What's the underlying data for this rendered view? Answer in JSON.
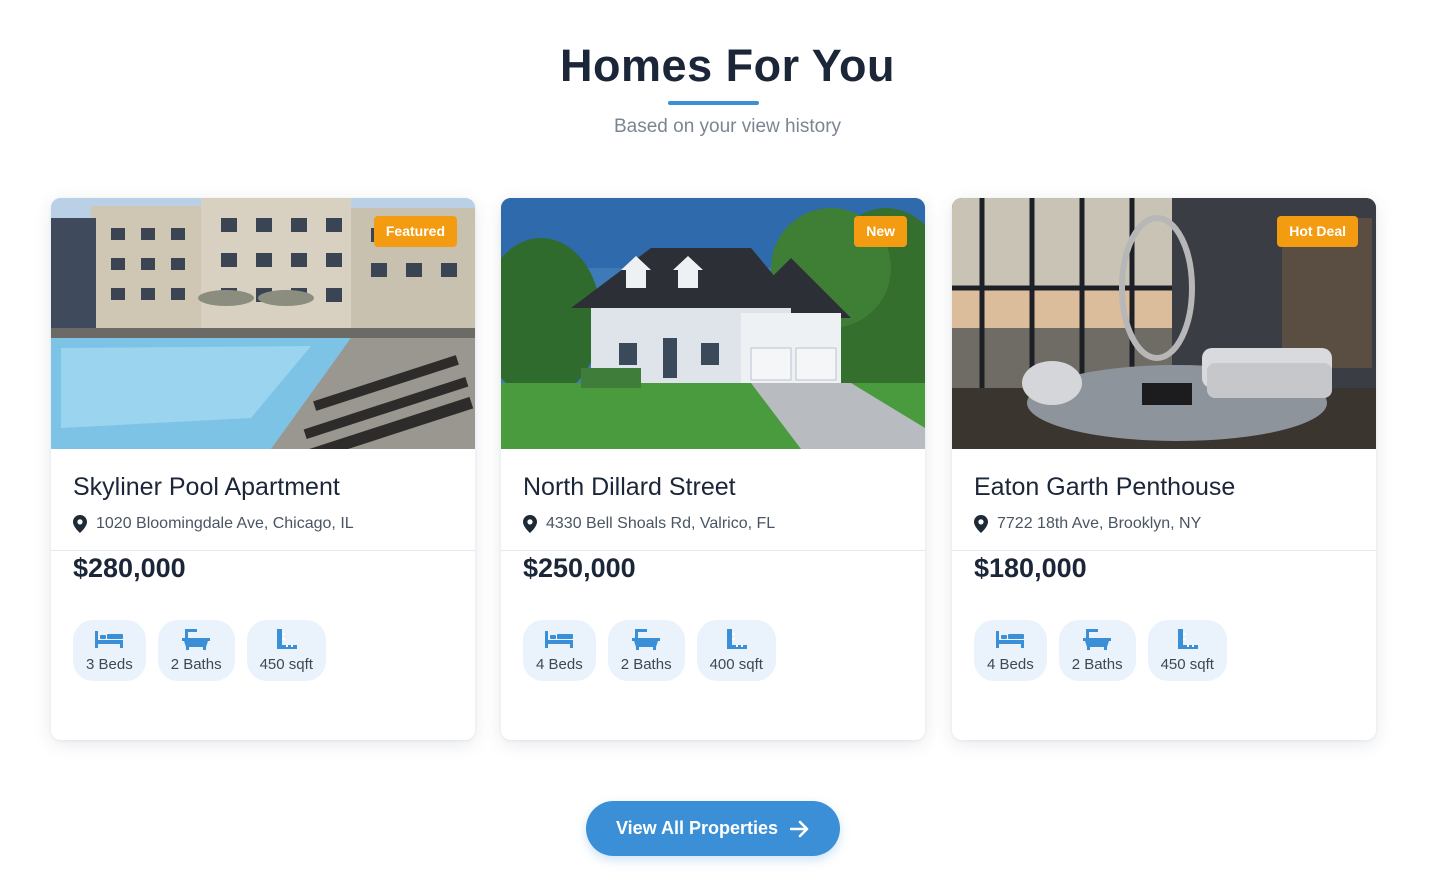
{
  "section": {
    "title": "Homes For You",
    "subtitle": "Based on your view history"
  },
  "colors": {
    "accent": "#3a8fd6",
    "badge": "#f39c12",
    "title": "#1b2638"
  },
  "listings": [
    {
      "badge": "Featured",
      "name": "Skyliner Pool Apartment",
      "address": "1020 Bloomingdale Ave, Chicago, IL",
      "price": "$280,000",
      "beds": "3 Beds",
      "baths": "2 Baths",
      "area": "450 sqft",
      "image": "apartment-pool-photo"
    },
    {
      "badge": "New",
      "name": "North Dillard Street",
      "address": "4330 Bell Shoals Rd, Valrico, FL",
      "price": "$250,000",
      "beds": "4 Beds",
      "baths": "2 Baths",
      "area": "400 sqft",
      "image": "suburban-house-photo"
    },
    {
      "badge": "Hot Deal",
      "name": "Eaton Garth Penthouse",
      "address": "7722 18th Ave, Brooklyn, NY",
      "price": "$180,000",
      "beds": "4 Beds",
      "baths": "2 Baths",
      "area": "450 sqft",
      "image": "penthouse-interior-photo"
    }
  ],
  "icons": {
    "address": "map-pin-icon",
    "beds": "bed-icon",
    "baths": "bathtub-icon",
    "area": "ruler-icon",
    "cta": "arrow-right-icon"
  },
  "cta": {
    "label": "View All Properties"
  }
}
